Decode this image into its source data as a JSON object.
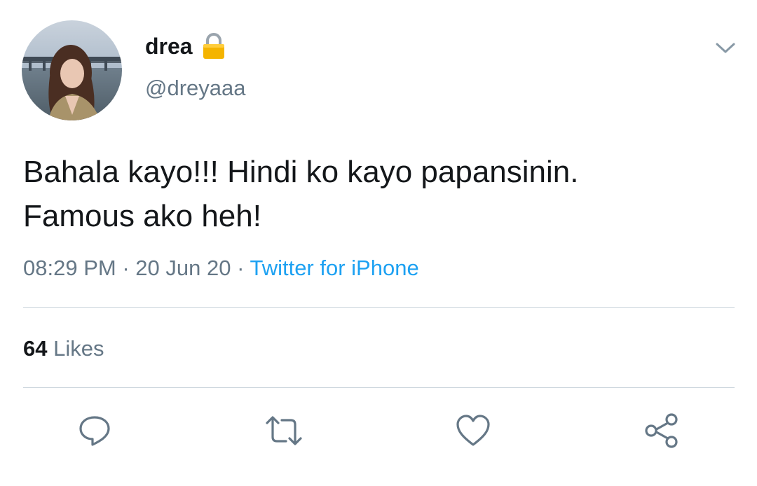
{
  "author": {
    "display_name": "drea",
    "handle": "@dreyaaa",
    "protected_icon": "lock-icon"
  },
  "tweet": {
    "text": "Bahala kayo!!! Hindi ko kayo papansinin.\nFamous ako heh!",
    "time": "08:29 PM",
    "separator": "·",
    "date": "20 Jun 20",
    "source": "Twitter for iPhone"
  },
  "stats": {
    "likes_count": "64",
    "likes_label": "Likes"
  },
  "actions": [
    {
      "name": "reply",
      "icon": "comment-icon"
    },
    {
      "name": "retweet",
      "icon": "retweet-icon"
    },
    {
      "name": "like",
      "icon": "heart-icon"
    },
    {
      "name": "share",
      "icon": "share-icon"
    }
  ],
  "colors": {
    "text": "#14171a",
    "secondary": "#657786",
    "link": "#1da1f2",
    "divider": "#ccd6dd",
    "icon": "#657786"
  }
}
